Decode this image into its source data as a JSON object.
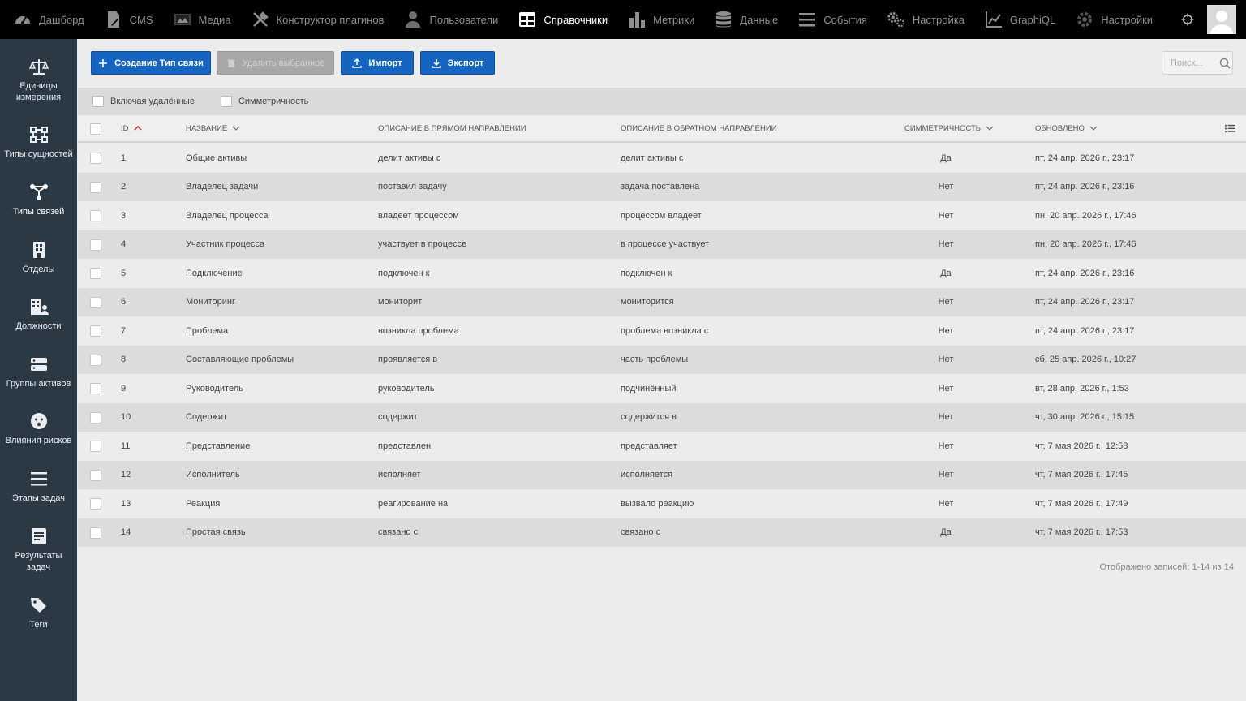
{
  "nav": [
    {
      "label": "Дашборд",
      "icon": "dashboard-icon"
    },
    {
      "label": "CMS",
      "icon": "cms-icon"
    },
    {
      "label": "Медиа",
      "icon": "media-icon"
    },
    {
      "label": "Конструктор плагинов",
      "icon": "tools-icon"
    },
    {
      "label": "Пользователи",
      "icon": "user-icon"
    },
    {
      "label": "Справочники",
      "icon": "table-icon"
    },
    {
      "label": "Метрики",
      "icon": "bar-chart-icon"
    },
    {
      "label": "Данные",
      "icon": "database-icon"
    },
    {
      "label": "События",
      "icon": "menu-icon"
    },
    {
      "label": "Настройка",
      "icon": "gears-icon"
    },
    {
      "label": "GraphiQL",
      "icon": "graph-icon"
    },
    {
      "label": "Настройки",
      "icon": "gear-icon"
    }
  ],
  "active_nav": "Справочники",
  "sidebar": [
    {
      "label": "Единицы измерения",
      "icon": "scale-icon"
    },
    {
      "label": "Типы сущностей",
      "icon": "entity-types-icon"
    },
    {
      "label": "Типы связей",
      "icon": "relation-types-icon"
    },
    {
      "label": "Отделы",
      "icon": "building-icon"
    },
    {
      "label": "Должности",
      "icon": "positions-icon"
    },
    {
      "label": "Группы активов",
      "icon": "asset-groups-icon"
    },
    {
      "label": "Влияния рисков",
      "icon": "risk-impact-icon"
    },
    {
      "label": "Этапы задач",
      "icon": "list-icon"
    },
    {
      "label": "Результаты задач",
      "icon": "task-results-icon"
    },
    {
      "label": "Теги",
      "icon": "tags-icon"
    }
  ],
  "toolbar": {
    "create_label": "Создание Тип связи",
    "delete_label": "Удалить выбранное",
    "import_label": "Импорт",
    "export_label": "Экспорт",
    "search_placeholder": "Поиск..."
  },
  "filters": {
    "include_deleted": "Включая удалённые",
    "symmetry": "Симметричность"
  },
  "columns": {
    "id": "ID",
    "name": "Название",
    "forward": "Описание в прямом направлении",
    "reverse": "Описание в обратном направлении",
    "symmetry": "Симметричность",
    "updated": "Обновлено"
  },
  "rows": [
    {
      "id": "1",
      "name": "Общие активы",
      "forward": "делит активы с",
      "reverse": "делит активы с",
      "symmetric": "Да",
      "updated": "пт, 24 апр. 2026 г., 23:17"
    },
    {
      "id": "2",
      "name": "Владелец задачи",
      "forward": "поставил задачу",
      "reverse": "задача поставлена",
      "symmetric": "Нет",
      "updated": "пт, 24 апр. 2026 г., 23:16"
    },
    {
      "id": "3",
      "name": "Владелец процесса",
      "forward": "владеет процессом",
      "reverse": "процессом владеет",
      "symmetric": "Нет",
      "updated": "пн, 20 апр. 2026 г., 17:46"
    },
    {
      "id": "4",
      "name": "Участник процесса",
      "forward": "участвует в процессе",
      "reverse": "в процессе участвует",
      "symmetric": "Нет",
      "updated": "пн, 20 апр. 2026 г., 17:46"
    },
    {
      "id": "5",
      "name": "Подключение",
      "forward": "подключен к",
      "reverse": "подключен к",
      "symmetric": "Да",
      "updated": "пт, 24 апр. 2026 г., 23:16"
    },
    {
      "id": "6",
      "name": "Мониторинг",
      "forward": "мониторит",
      "reverse": "мониторится",
      "symmetric": "Нет",
      "updated": "пт, 24 апр. 2026 г., 23:17"
    },
    {
      "id": "7",
      "name": "Проблема",
      "forward": "возникла проблема",
      "reverse": "проблема возникла с",
      "symmetric": "Нет",
      "updated": "пт, 24 апр. 2026 г., 23:17"
    },
    {
      "id": "8",
      "name": "Составляющие проблемы",
      "forward": "проявляется в",
      "reverse": "часть проблемы",
      "symmetric": "Нет",
      "updated": "сб, 25 апр. 2026 г., 10:27"
    },
    {
      "id": "9",
      "name": "Руководитель",
      "forward": "руководитель",
      "reverse": "подчинённый",
      "symmetric": "Нет",
      "updated": "вт, 28 апр. 2026 г., 1:53"
    },
    {
      "id": "10",
      "name": "Содержит",
      "forward": "содержит",
      "reverse": "содержится в",
      "symmetric": "Нет",
      "updated": "чт, 30 апр. 2026 г., 15:15"
    },
    {
      "id": "11",
      "name": "Представление",
      "forward": "представлен",
      "reverse": "представляет",
      "symmetric": "Нет",
      "updated": "чт, 7 мая 2026 г., 12:58"
    },
    {
      "id": "12",
      "name": "Исполнитель",
      "forward": "исполняет",
      "reverse": "исполняется",
      "symmetric": "Нет",
      "updated": "чт, 7 мая 2026 г., 17:45"
    },
    {
      "id": "13",
      "name": "Реакция",
      "forward": "реагирование на",
      "reverse": "вызвало реакцию",
      "symmetric": "Нет",
      "updated": "чт, 7 мая 2026 г., 17:49"
    },
    {
      "id": "14",
      "name": "Простая связь",
      "forward": "связано с",
      "reverse": "связано с",
      "symmetric": "Да",
      "updated": "чт, 7 мая 2026 г., 17:53"
    }
  ],
  "footer": "Отображено записей: 1-14 из 14",
  "colors": {
    "primary": "#1565c0",
    "topbar": "#000000",
    "sidebar": "#2b3945",
    "sort_asc": "#c62828"
  }
}
